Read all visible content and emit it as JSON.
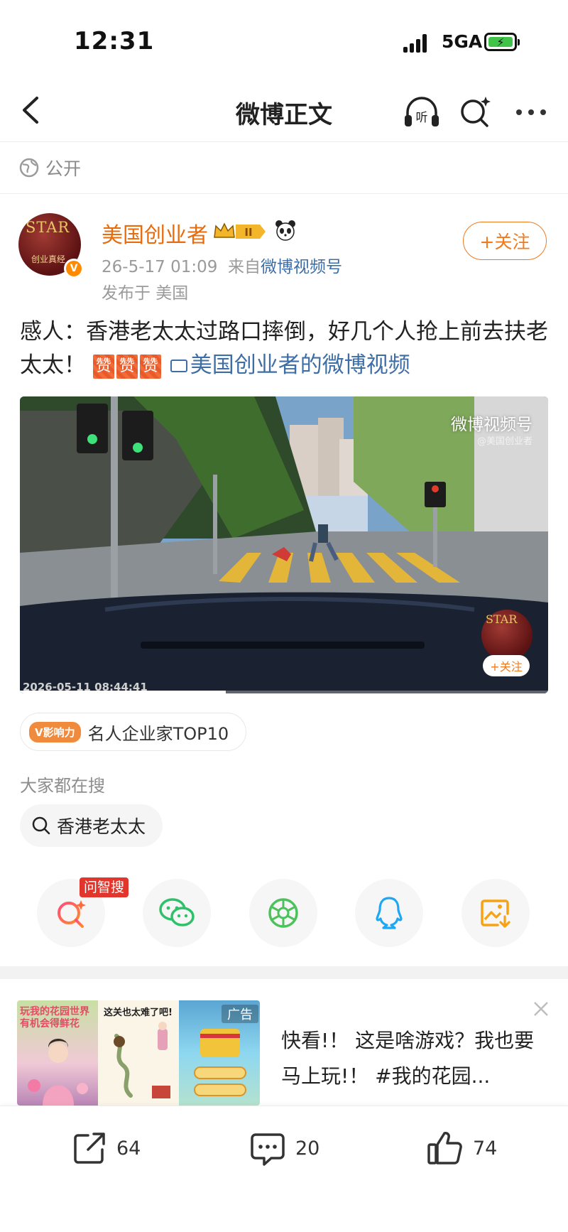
{
  "status_bar": {
    "time": "12:31",
    "network": "5GA"
  },
  "nav": {
    "title": "微博正文",
    "listen_label": "听"
  },
  "visibility": {
    "label": "公开"
  },
  "author": {
    "name": "美国创业者",
    "level_badge": "II",
    "avatar_text_top": "STAR",
    "avatar_text_bottom": "创业真经",
    "verified_mark": "V",
    "timestamp": "26-5-17 01:09",
    "source_prefix": "来自",
    "source": "微博视频号",
    "location": "发布于 美国",
    "follow_label": "+关注"
  },
  "post": {
    "text": "感人：香港老太太过路口摔倒，好几个人抢上前去扶老太太！",
    "emojis": [
      "赞",
      "赞",
      "赞"
    ],
    "video_link": "美国创业者的微博视频"
  },
  "video": {
    "watermark": "微博视频号",
    "watermark_sub": "@美国创业者",
    "timestamp": "2026-05-11 08:44:41",
    "progress": 0.39,
    "mini_avatar_text": "STAR",
    "mini_follow_label": "+关注"
  },
  "influence": {
    "tag": "V影响力",
    "text": "名人企业家TOP10"
  },
  "search": {
    "hint": "大家都在搜",
    "term": "香港老太太"
  },
  "share": {
    "ai_badge": "问智搜",
    "items": [
      "ai-search-icon",
      "wechat-icon",
      "moments-icon",
      "qq-icon",
      "save-image-icon"
    ]
  },
  "ad": {
    "label": "广告",
    "panel_a_title": "玩我的花园世界 有机会得鲜花",
    "panel_b_title": "这关也太难了吧!",
    "text": "快看!！ 这是啥游戏？我也要马上玩!！ #我的花园..."
  },
  "actions": {
    "repost": "64",
    "comment": "20",
    "like": "74"
  },
  "colors": {
    "accent": "#f07a1e",
    "link": "#3e6ea6",
    "brand_name": "#e86b0c"
  }
}
